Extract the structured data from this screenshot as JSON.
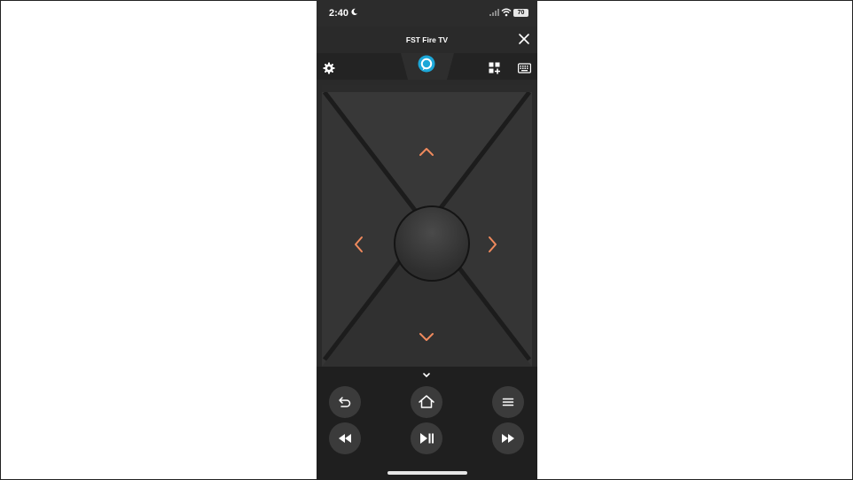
{
  "status_bar": {
    "time": "2:40",
    "battery": "70",
    "icons": [
      "moon-icon",
      "cellular-signal-icon",
      "wifi-icon",
      "battery-icon"
    ]
  },
  "header": {
    "device_name": "FST Fire TV",
    "close_icon": "close-icon"
  },
  "toolbar": {
    "left": "gear-icon",
    "center": "alexa-icon",
    "right": [
      "apps-icon",
      "keyboard-icon"
    ]
  },
  "dpad": {
    "arrows": [
      "chevron-up-icon",
      "chevron-left-icon",
      "chevron-right-icon",
      "chevron-down-icon"
    ],
    "center": "select-button"
  },
  "controls": {
    "collapse": "chevron-down-icon",
    "row1": [
      "back-icon",
      "home-icon",
      "menu-icon"
    ],
    "row2": [
      "rewind-icon",
      "play-pause-icon",
      "fast-forward-icon"
    ]
  },
  "colors": {
    "accent": "#f08a5d",
    "alexa_blue": "#1ca7d8",
    "background": "#2a2a2a",
    "button": "#3b3b3b"
  }
}
